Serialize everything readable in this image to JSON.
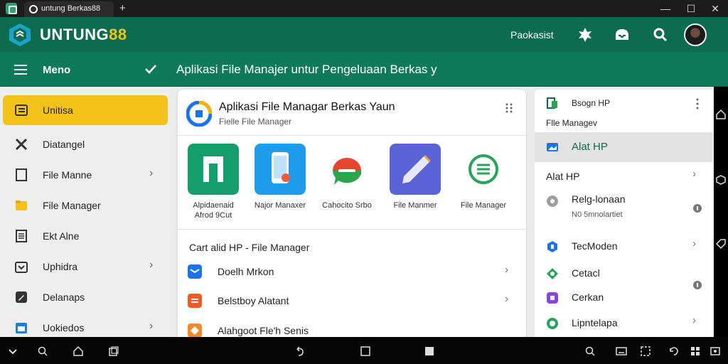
{
  "browser": {
    "tab_title": "untung Berkas88",
    "new_tab": "+",
    "minimize": "—",
    "maximize": "☐",
    "close": "✕"
  },
  "header": {
    "brand_main": "UNTUNG",
    "brand_accent": "88",
    "link_label": "Paokasist"
  },
  "subheader": {
    "menu_label": "Meno",
    "page_heading": "Aplikasi File Manajer untur Pengeluaan Berkas y"
  },
  "sidebar": {
    "items": [
      {
        "label": "Unitisa",
        "icon": "list-icon",
        "chevron": false,
        "active": true
      },
      {
        "label": "Diatangel",
        "icon": "crossed-tools-icon",
        "chevron": false,
        "active": false
      },
      {
        "label": "File Manne",
        "icon": "square-icon",
        "chevron": true,
        "active": false
      },
      {
        "label": "File Manager",
        "icon": "folder-icon",
        "chevron": true,
        "active": false
      },
      {
        "label": "Ekt Alne",
        "icon": "document-icon",
        "chevron": false,
        "active": false
      },
      {
        "label": "Uphidra",
        "icon": "download-tray-icon",
        "chevron": true,
        "active": false
      },
      {
        "label": "Delanaps",
        "icon": "edit-icon",
        "chevron": false,
        "active": false
      },
      {
        "label": "Uokiedos",
        "icon": "calendar-icon",
        "chevron": true,
        "active": false
      }
    ]
  },
  "card": {
    "title": "Aplikasi File Managar Berkas  Yaun",
    "subtitle": "Fielle File Manager",
    "apps": [
      {
        "label_line1": "Alpidaenaid",
        "label_line2": "Afrod 9Cut",
        "icon": "green-folder-icon"
      },
      {
        "label_line1": "Najor Manaxer",
        "label_line2": "",
        "icon": "phone-app-icon"
      },
      {
        "label_line1": "Cahocito Srbo",
        "label_line2": "",
        "icon": "chat-bubble-icon"
      },
      {
        "label_line1": "File Manmer",
        "label_line2": "",
        "icon": "pencil-app-icon"
      },
      {
        "label_line1": "File Manager",
        "label_line2": "",
        "icon": "green-message-icon"
      }
    ],
    "section_title": "Cart alid HP  - File Manager",
    "list": [
      {
        "label": "Doelh Mrkon",
        "icon": "mail-icon",
        "chevron": true
      },
      {
        "label": "Belstboy Alatant",
        "icon": "orange-list-icon",
        "chevron": true
      },
      {
        "label": "Alahgoot Fle'h Senis",
        "icon": "orange-diamond-icon",
        "chevron": false
      }
    ]
  },
  "right_panel": {
    "top_title": "Bsogn HP",
    "top_sub": "Flle  Managev",
    "highlight_label": "Alat HP",
    "rows": [
      {
        "label": "Alat HP",
        "sub": "",
        "icon": "",
        "chevron": true
      },
      {
        "label": "Relg-lonaan",
        "sub": "N0 5mnolartiet",
        "icon": "gray-circle-icon",
        "chevron": false
      },
      {
        "label": "TecModen",
        "sub": "",
        "icon": "blue-hex-icon",
        "chevron": true
      },
      {
        "label": "Cetacl",
        "sub": "",
        "icon": "green-diamond-icon",
        "chevron": false
      },
      {
        "label": "Cerkan",
        "sub": "",
        "icon": "purple-box-icon",
        "chevron": false
      },
      {
        "label": "Lipntelapa",
        "sub": "",
        "icon": "green-circle-icon",
        "chevron": true
      }
    ]
  },
  "colors": {
    "header_green": "#0d6b4e",
    "subheader_green": "#0f7a59",
    "accent_yellow": "#f4c31b",
    "highlight_green_text": "#0d6b4e"
  }
}
